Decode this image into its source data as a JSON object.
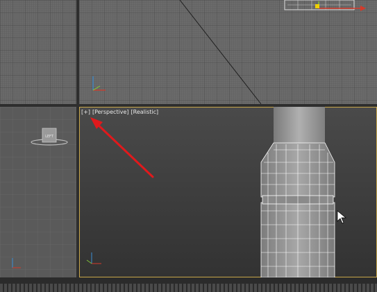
{
  "viewport_label": {
    "plus": "[+]",
    "view_mode": "[Perspective]",
    "shading_mode": "[Realistic]"
  },
  "cube": {
    "face_text": "LEFT"
  },
  "colors": {
    "active_border": "#c9a74a",
    "annotation_arrow": "#e0191c",
    "axis_x": "#d43a2a",
    "axis_y": "#3a8fd4",
    "axis_z": "#7fbf3a"
  },
  "icons": {
    "cursor": "mouse-pointer-icon",
    "arrow": "red-arrow-icon"
  }
}
